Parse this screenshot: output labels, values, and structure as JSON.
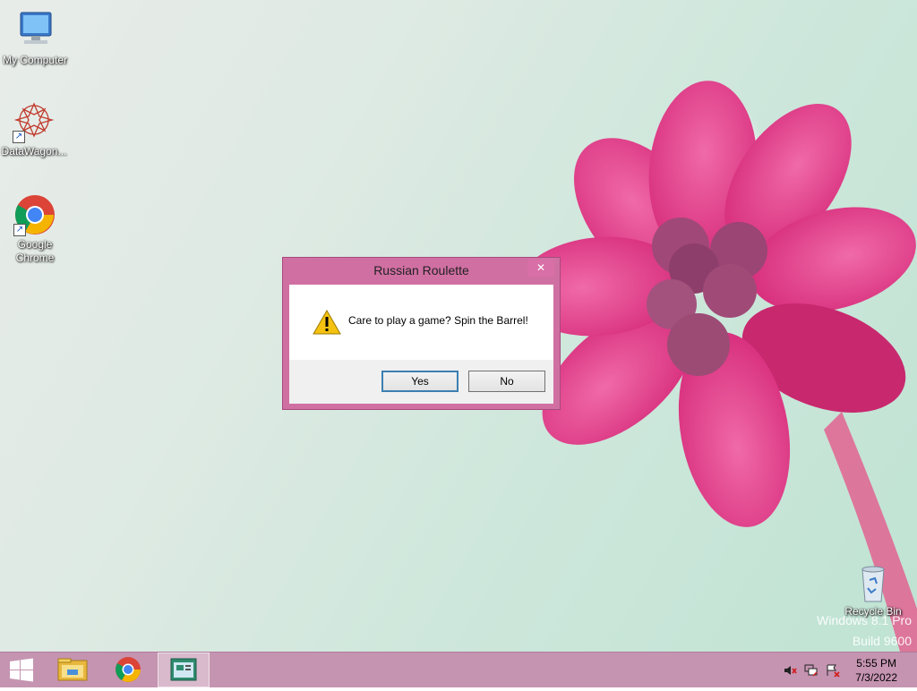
{
  "desktop": {
    "icons": [
      {
        "label": "My Computer"
      },
      {
        "label": "DataWagon..."
      },
      {
        "label": "Google Chrome"
      },
      {
        "label": "Recycle Bin"
      }
    ],
    "watermark": {
      "line1": "Windows 8.1 Pro",
      "line2": "Build 9600"
    }
  },
  "dialog": {
    "title": "Russian Roulette",
    "close_glyph": "✕",
    "message": "Care to play a game? Spin the Barrel!",
    "icon": "warning-icon",
    "buttons": {
      "yes": "Yes",
      "no": "No"
    }
  },
  "taskbar": {
    "items": [
      "start-icon",
      "file-explorer-icon",
      "chrome-icon",
      "app-window-icon"
    ],
    "tray": [
      "volume-muted-icon",
      "network-icon",
      "action-center-icon"
    ],
    "clock": {
      "time": "5:55 PM",
      "date": "7/3/2022"
    }
  },
  "colors": {
    "accent": "#d06fa2",
    "taskbar": "#c594b1"
  }
}
